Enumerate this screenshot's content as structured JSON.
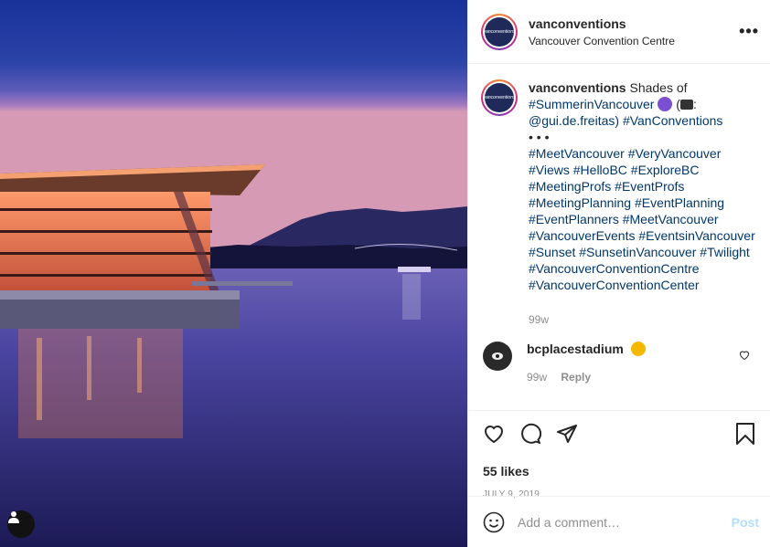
{
  "post": {
    "username": "vanconventions",
    "location": "Vancouver Convention Centre",
    "avatar_text": "vanconventions"
  },
  "caption": {
    "username": "vanconventions",
    "text_before": "Shades of",
    "tag_summer": "#SummerinVancouver",
    "text_paren_open": "(",
    "text_colon": ":",
    "mention": "@gui.de.freitas)",
    "tag_vanconv": "#VanConventions",
    "dots": "• • •",
    "hashtags": [
      "#MeetVancouver #VeryVancouver",
      "#Views #HelloBC #ExploreBC",
      "#MeetingProfs #EventProfs",
      "#MeetingPlanning #EventPlanning",
      "#EventPlanners #MeetVancouver",
      "#VancouverEvents #EventsinVancouver",
      "#Sunset #SunsetinVancouver #Twilight",
      "#VancouverConventionCentre",
      "#VancouverConventionCenter"
    ],
    "time": "99w"
  },
  "comments": [
    {
      "username": "bcplacestadium",
      "time": "99w",
      "reply_label": "Reply"
    }
  ],
  "actions": {
    "likes": "55 likes",
    "date": "JULY 9, 2019"
  },
  "add_comment": {
    "placeholder": "Add a comment…",
    "post_label": "Post"
  },
  "icons": [
    "user-tag-icon",
    "more-options-icon",
    "heart-icon",
    "comment-icon",
    "share-icon",
    "bookmark-icon",
    "emoji-icon",
    "heart-small-icon"
  ],
  "colors": {
    "accent_link": "#00376b",
    "muted": "#8e8e8e",
    "post_disabled": "#b2dffc",
    "border": "#efefef"
  }
}
